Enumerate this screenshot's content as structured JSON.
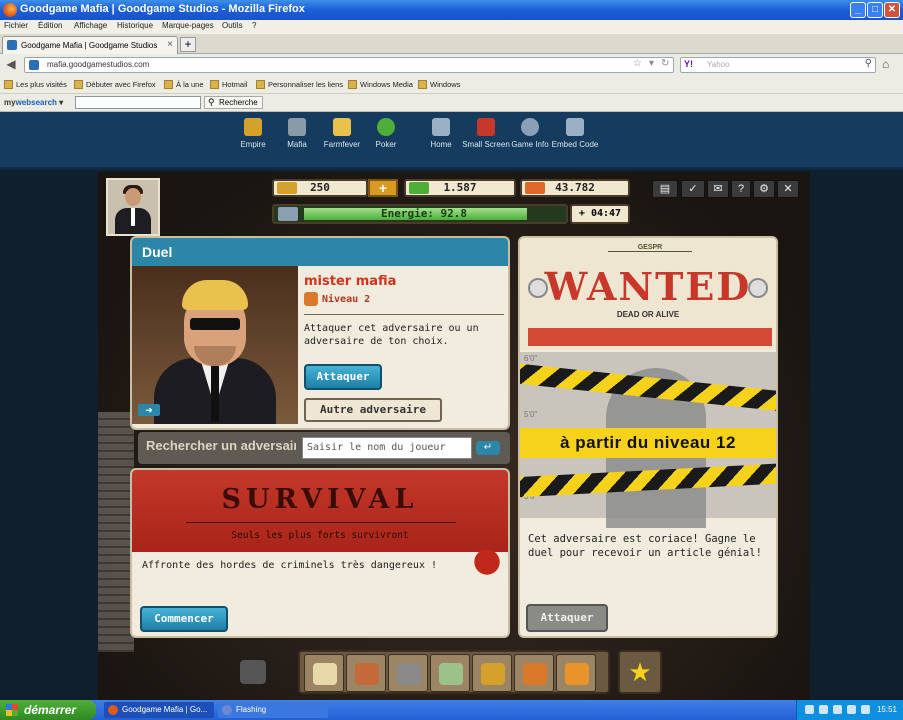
{
  "window": {
    "title": "Goodgame Mafia | Goodgame Studios - Mozilla Firefox",
    "buttons": [
      "_",
      "□",
      "✕"
    ]
  },
  "menu": [
    "Fichier",
    "Édition",
    "Affichage",
    "Historique",
    "Marque-pages",
    "Outils",
    "?"
  ],
  "tab": {
    "title": "Goodgame Mafia | Goodgame Studios",
    "close": "×",
    "new": "+"
  },
  "nav": {
    "url": "mafia.goodgamestudios.com",
    "search_brand": "Y!",
    "search_placeholder": "Yahoo"
  },
  "bookmarks": [
    "Les plus visités",
    "Débuter avec Firefox",
    "À la une",
    "Hotmail",
    "Personnaliser les liens",
    "Windows Media",
    "Windows"
  ],
  "mywebsearch": {
    "logo_prefix": "my",
    "logo_main": "websearch",
    "button": "Recherche"
  },
  "portal": {
    "items": [
      {
        "label": "Empire",
        "color": "#d4a12c"
      },
      {
        "label": "Mafia",
        "color": "#8a9aa8"
      },
      {
        "label": "Farmfever",
        "color": "#e8c24c"
      },
      {
        "label": "Poker",
        "color": "#4fae3a"
      },
      {
        "label": "Home",
        "color": "#9ab0c4"
      },
      {
        "label": "Small Screen",
        "color": "#c8382a"
      },
      {
        "label": "Game Info",
        "color": "#8aa0b8"
      },
      {
        "label": "Embed Code",
        "color": "#9ab0c4"
      }
    ]
  },
  "hud": {
    "gold": "250",
    "plus": "+",
    "cash": "1.587",
    "respect": "43.782",
    "energy_label": "Energie: 92.8",
    "energy_fraction": 0.928,
    "timer": "+ 04:47"
  },
  "duel": {
    "header": "Duel",
    "opponent_name": "mister mafia",
    "opponent_level": "Niveau 2",
    "text": "Attaquer cet adversaire ou un adversaire de ton choix.",
    "attack_button": "Attaquer",
    "other_button": "Autre adversaire",
    "portrait_arrow": "➜"
  },
  "search": {
    "label": "Rechercher un adversaire",
    "placeholder": "Saisir le nom du joueur",
    "go": "↵"
  },
  "survival": {
    "title": "SURVIVAL",
    "subtitle": "Seuls les plus forts survivront",
    "description": "Affronte des hordes de criminels très dangereux !",
    "button": "Commencer"
  },
  "wanted": {
    "header": "GESPR",
    "title": "WANTED",
    "subtitle": "DEAD OR ALIVE",
    "level_banner": "à partir du niveau 12",
    "heights": [
      "6'0\"",
      "5'0\"",
      "3'6\""
    ],
    "description": "Cet adversaire est coriace! Gagne le duel pour recevoir un article génial!",
    "button": "Attaquer"
  },
  "taskbar": {
    "start": "démarrer",
    "tasks": [
      "Goodgame Mafia | Go...",
      "Flashing"
    ],
    "clock": "15:51"
  }
}
